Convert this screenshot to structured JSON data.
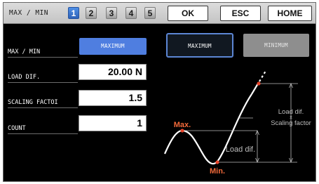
{
  "header": {
    "title": "MAX / MIN",
    "page_tabs": [
      "1",
      "2",
      "3",
      "4",
      "5"
    ],
    "active_tab": "1",
    "ok_label": "OK",
    "esc_label": "ESC",
    "home_label": "HOME"
  },
  "settings": {
    "mode_label": "MAX / MIN",
    "mode_value": "MAXIMUM",
    "load_dif_label": "LOAD DIF.",
    "load_dif_value": "20.00 N",
    "scaling_factor_label": "SCALING FACTOI",
    "scaling_factor_value": "1.5",
    "count_label": "COUNT",
    "count_value": "1"
  },
  "mode_buttons": {
    "maximum_label": "MAXIMUM",
    "minimum_label": "MINIMUM",
    "selected": "MAXIMUM"
  },
  "diagram": {
    "max_label": "Max.",
    "min_label": "Min.",
    "load_dif_label": "Load dif.",
    "upper_line1": "Load dif.",
    "upper_line2": "x",
    "upper_line3": "Scaling factor"
  },
  "colors": {
    "background": "#000000",
    "accent_blue": "#4f7ee0",
    "marker_red": "#e8452b",
    "label_orange": "#f26a3a",
    "dim_gray": "#bdbdbd"
  }
}
